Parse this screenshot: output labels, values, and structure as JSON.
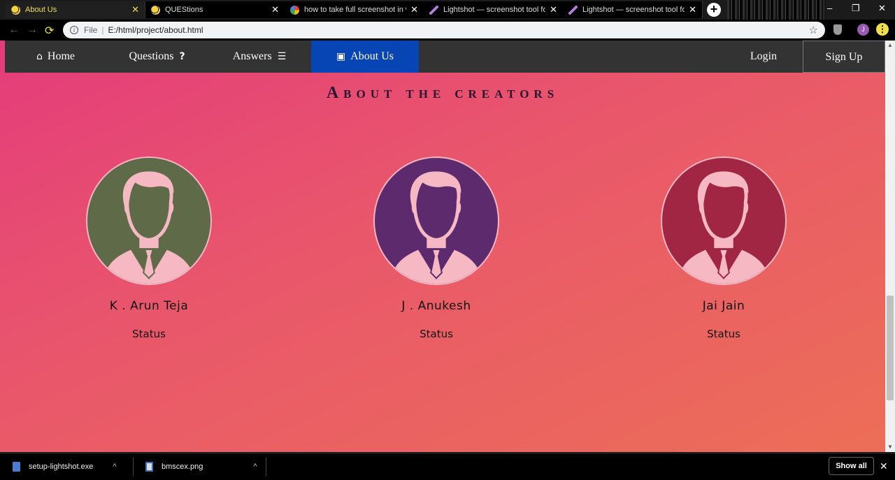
{
  "browser": {
    "tabs": [
      {
        "title": "About Us",
        "favicon": "globe-icon",
        "active": true
      },
      {
        "title": "QUEStions",
        "favicon": "globe-icon",
        "active": false
      },
      {
        "title": "how to take full screenshot in wi",
        "favicon": "google-icon",
        "active": false
      },
      {
        "title": "Lightshot — screenshot tool for I",
        "favicon": "feather-icon",
        "active": false
      },
      {
        "title": "Lightshot — screenshot tool for I",
        "favicon": "feather-icon",
        "active": false
      }
    ],
    "tab_close_glyph": "✕",
    "new_tab_glyph": "+",
    "address": {
      "scheme": "File",
      "separator": "|",
      "url": "E:/html/project/about.html"
    },
    "profile_initial": "J",
    "menu_glyph": "⋮",
    "back_glyph": "←",
    "forward_glyph": "→",
    "reload_glyph": "⟳",
    "star_glyph": "☆"
  },
  "site_nav": {
    "home": "Home",
    "questions": "Questions",
    "answers": "Answers",
    "about": "About Us",
    "login": "Login",
    "signup": "Sign Up",
    "home_icon": "⌂",
    "questions_icon": "?",
    "answers_icon": "☰",
    "about_icon": "▣"
  },
  "page": {
    "heading": "About the creators",
    "creators": [
      {
        "name": "K . Arun Teja",
        "status": "Status",
        "bg": "#5f6a48"
      },
      {
        "name": "J . Anukesh",
        "status": "Status",
        "bg": "#5e2a6e"
      },
      {
        "name": "Jai Jain",
        "status": "Status",
        "bg": "#a12644"
      }
    ]
  },
  "downloads": {
    "items": [
      {
        "filename": "setup-lightshot.exe",
        "icon": "exe-file-icon"
      },
      {
        "filename": "bmscex.png",
        "icon": "image-file-icon"
      }
    ],
    "chevron_glyph": "^",
    "show_all": "Show all",
    "close_glyph": "✕"
  },
  "colors": {
    "active_tab_text": "#f0e04a",
    "nav_active": "#0645b3",
    "nav_bg": "#333333",
    "page_gradient_start": "#e43c7b",
    "page_gradient_end": "#ec6e57"
  }
}
